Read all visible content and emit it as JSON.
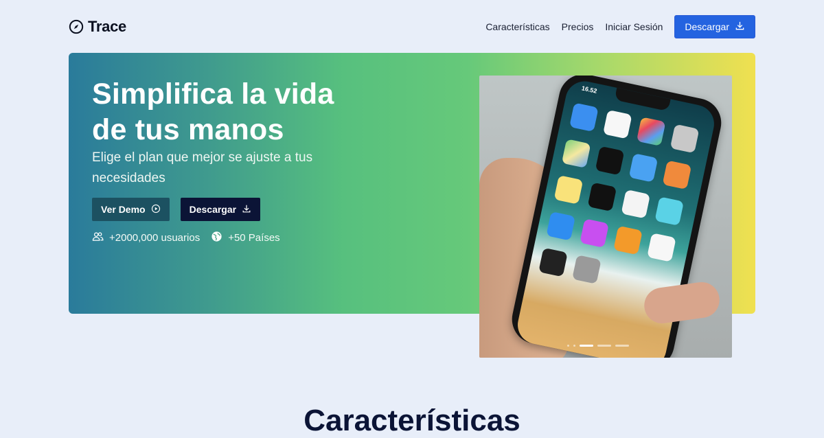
{
  "brand": {
    "name": "Trace",
    "icon": "compass-icon"
  },
  "nav": {
    "items": [
      {
        "label": "Características"
      },
      {
        "label": "Precios"
      },
      {
        "label": "Iniciar Sesión"
      }
    ],
    "download_label": "Descargar",
    "download_icon": "download-icon",
    "accent": "#2463e0"
  },
  "hero": {
    "title_line1": "Simplifica la vida",
    "title_line2": "de tus manos",
    "subtitle": "Elige el plan que mejor se ajuste a tus necesidades",
    "demo_label": "Ver Demo",
    "demo_icon": "play-circle-icon",
    "download_label": "Descargar",
    "download_icon": "download-icon",
    "stats": [
      {
        "icon": "users-icon",
        "text": "+2000,000 usuarios"
      },
      {
        "icon": "globe-icon",
        "text": "+50 Países"
      }
    ],
    "gradient": [
      "#2a7b9b",
      "#57c07e",
      "#f0e050"
    ]
  },
  "phone_image": {
    "time": "16.52"
  },
  "section": {
    "title": "Características"
  }
}
